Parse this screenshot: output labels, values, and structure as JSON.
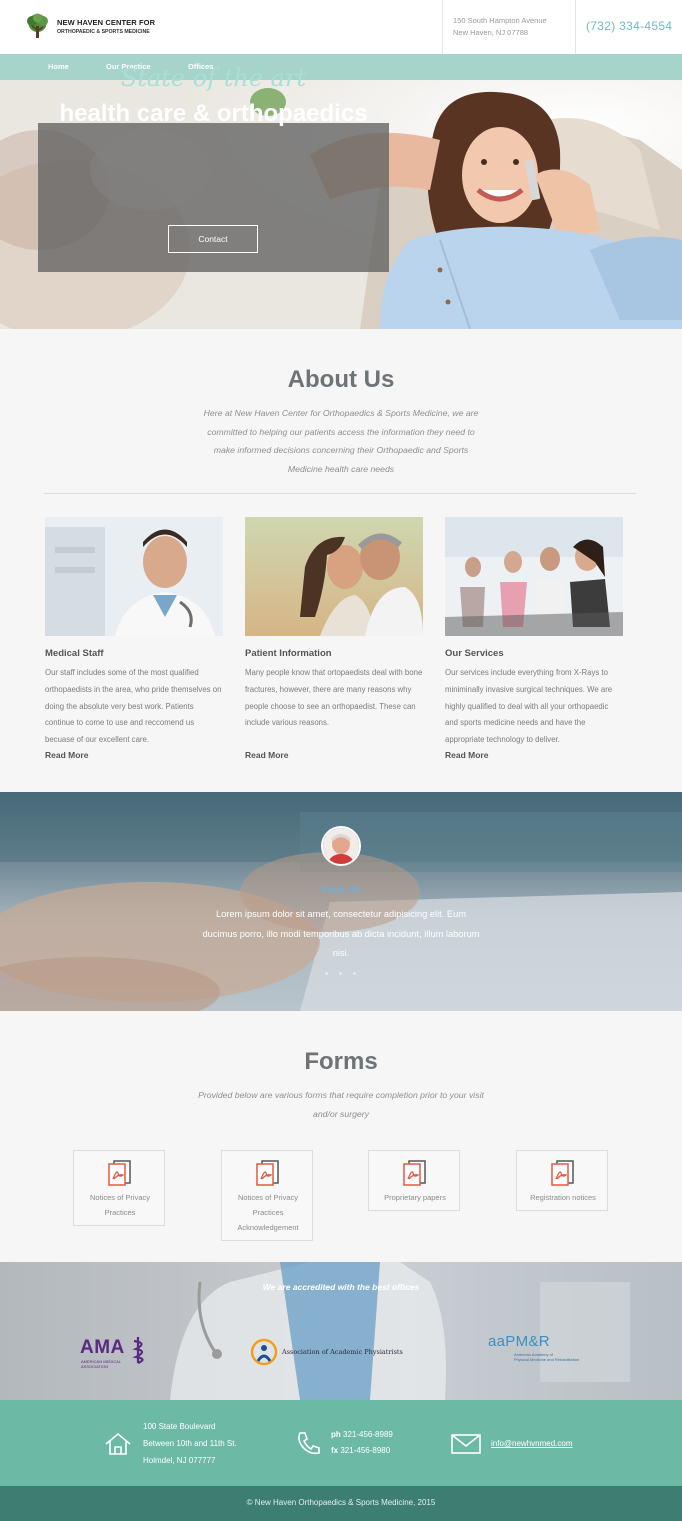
{
  "header": {
    "logo_line1": "NEW HAVEN CENTER FOR",
    "logo_line2": "ORTHOPAEDIC & SPORTS MEDICINE",
    "address_line1": "150 South Hampton Avenue",
    "address_line2": "New Haven, NJ 07788",
    "phone": "(732) 334-4554"
  },
  "nav": {
    "items": [
      "Home",
      "Our Practice",
      "Offices"
    ]
  },
  "hero": {
    "script": "State of the art",
    "title": "health care & orthopaedics",
    "button": "Contact"
  },
  "about": {
    "title": "About Us",
    "text": "Here at New Haven Center for Orthopaedics & Sports Medicine, we are committed to helping our patients access the information they need to make informed decisions concerning their Orthopaedic and Sports Medicine health care needs",
    "cards": [
      {
        "title": "Medical Staff",
        "text": "Our staff includes some of the most qualified orthopaedists in the area, who pride themselves on doing the absolute very best work. Patients continue to come to use and reccomend us becuase of our excellent care.",
        "link": "Read More"
      },
      {
        "title": "Patient Information",
        "text": "Many people know that ortopaedists deal with bone fractures, however, there are many reasons why people choose to see an orthopaedist. These can include various reasons.",
        "link": "Read More"
      },
      {
        "title": "Our Services",
        "text": "Our services include everything from X-Rays to miniminally invasive surgical techniques. We are highly qualified to deal with all your orthopaedic and sports medicine needs and have the appropriate technology to deliver.",
        "link": "Read More"
      }
    ]
  },
  "testimonial": {
    "name": "Fred, 84",
    "text": "Lorem ipsum dolor sit amet, consectetur adipisicing elit. Eum ducimus porro, illo modi temporibus ab dicta incidunt, illum laborum nisi."
  },
  "forms": {
    "title": "Forms",
    "text": "Provided below are various forms that require completion prior to your visit and/or surgery",
    "items": [
      "Notices of Privacy Practices",
      "Notices of Privacy Practices Acknowledgement",
      "Proprietary papers",
      "Registration notices"
    ]
  },
  "accreditation": {
    "title": "We are accredited with the best offices",
    "logos": {
      "ama": "AMA",
      "ama_sub1": "AMERICAN MEDICAL",
      "ama_sub2": "ASSOCIATION",
      "aap": "Association of Academic Physiatrists",
      "aapmr": "aaPM&R",
      "aapmr_sub1": "American Academy of",
      "aapmr_sub2": "Physical Medicine and Rehabilitation"
    }
  },
  "footer": {
    "address_line1": "100 State Boulevard",
    "address_line2": "Between 10th and 11th St.",
    "address_line3": "Holmdel, NJ 077777",
    "ph_label": "ph",
    "ph": "321-456-8989",
    "fx_label": "fx",
    "fx": "321-456-8980",
    "email": "info@newhvnmed.com",
    "copyright": "© New Haven Orthopaedics & Sports Medicine, 2015"
  },
  "colors": {
    "accent": "#a6d4cb",
    "phone": "#6bbdc0",
    "footer": "#6cb9a6",
    "copyright_bar": "#3c7e71",
    "pdf_red": "#e2583f"
  }
}
